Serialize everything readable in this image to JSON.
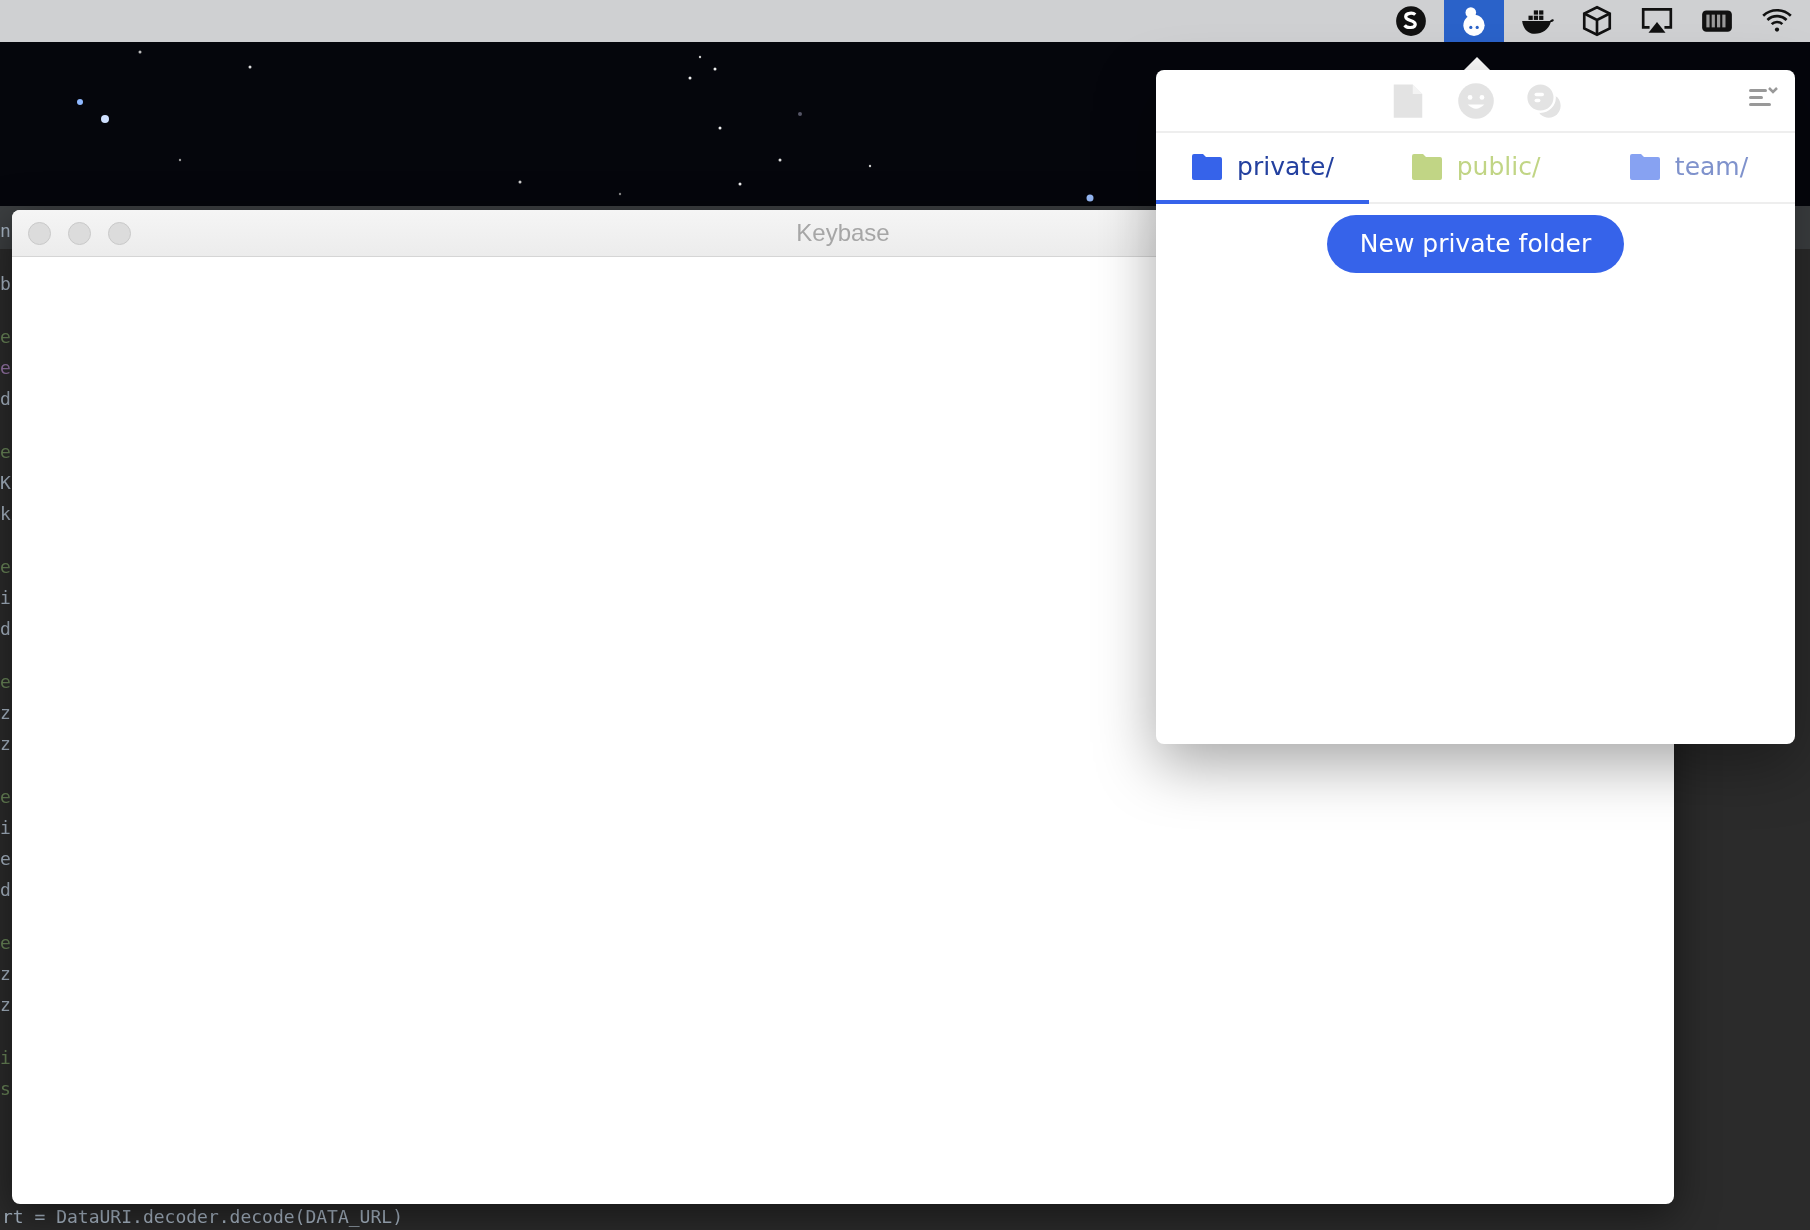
{
  "menu_bar": {
    "icons": [
      {
        "kind": "skype",
        "selected": false
      },
      {
        "kind": "keybase",
        "selected": true
      },
      {
        "kind": "docker",
        "selected": false
      },
      {
        "kind": "box",
        "selected": false
      },
      {
        "kind": "airplay",
        "selected": false
      },
      {
        "kind": "battery",
        "selected": false
      },
      {
        "kind": "wifi",
        "selected": false
      }
    ]
  },
  "editor": {
    "line_groups": [
      [
        {
          "text": "n",
          "kind": "plain"
        }
      ],
      [
        {
          "text": "b",
          "kind": "plain"
        }
      ],
      [
        {
          "text": "e",
          "kind": "keyword"
        },
        {
          "text": "e",
          "kind": "field"
        },
        {
          "text": "d",
          "kind": "plain"
        }
      ],
      [
        {
          "text": "e",
          "kind": "keyword"
        },
        {
          "text": "K",
          "kind": "plain"
        },
        {
          "text": "k",
          "kind": "plain"
        }
      ],
      [
        {
          "text": "e",
          "kind": "keyword"
        },
        {
          "text": "i",
          "kind": "plain"
        },
        {
          "text": "d",
          "kind": "plain"
        }
      ],
      [
        {
          "text": "e",
          "kind": "keyword"
        },
        {
          "text": "z",
          "kind": "plain"
        },
        {
          "text": "z",
          "kind": "plain"
        }
      ],
      [
        {
          "text": "e",
          "kind": "keyword"
        },
        {
          "text": "i",
          "kind": "plain"
        },
        {
          "text": "e",
          "kind": "plain"
        },
        {
          "text": "d",
          "kind": "plain"
        }
      ],
      [
        {
          "text": "e",
          "kind": "keyword"
        },
        {
          "text": "z",
          "kind": "plain"
        },
        {
          "text": "z",
          "kind": "plain"
        }
      ],
      [
        {
          "text": "i",
          "kind": "keyword"
        },
        {
          "text": "s",
          "kind": "keyword"
        }
      ]
    ],
    "bottom_line": "rt = DataURI.decoder.decode(DATA_URL)"
  },
  "window": {
    "title": "Keybase"
  },
  "popup": {
    "header_icons": [
      {
        "kind": "file"
      },
      {
        "kind": "smiley"
      },
      {
        "kind": "chat"
      }
    ],
    "tabs": [
      {
        "label": "private/",
        "selected": true,
        "color": "#3663ea"
      },
      {
        "label": "public/",
        "selected": false,
        "color": "#c1d585"
      },
      {
        "label": "team/",
        "selected": false,
        "color": "#87a2f2"
      }
    ],
    "button": "New private folder"
  }
}
